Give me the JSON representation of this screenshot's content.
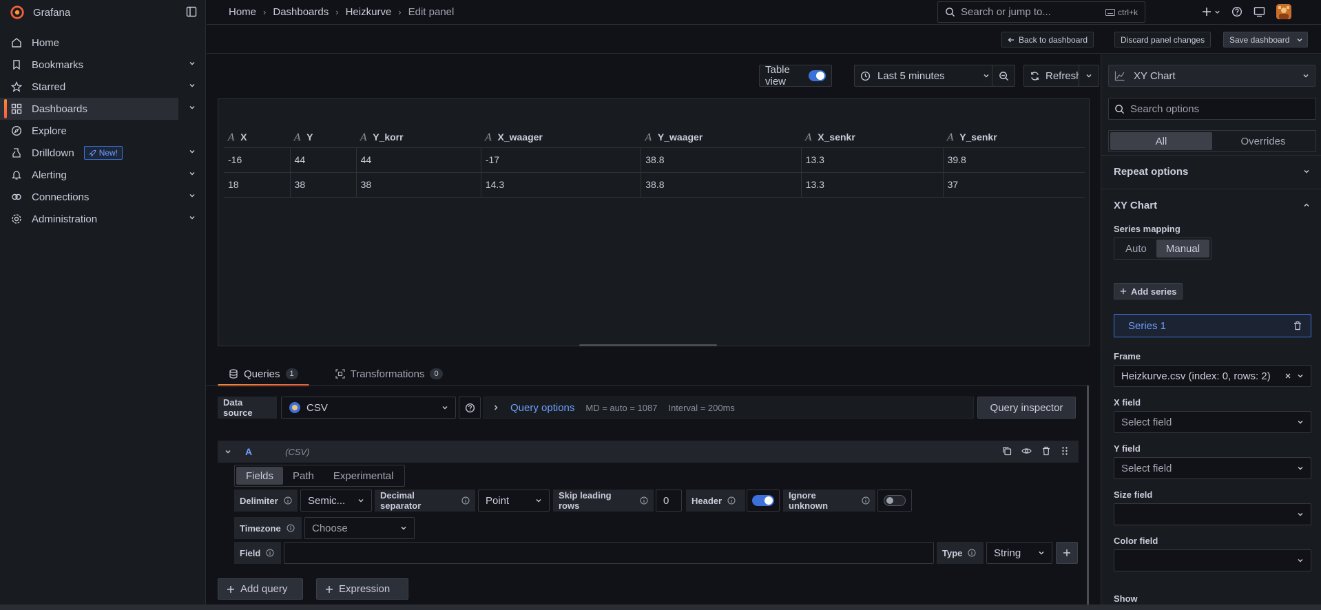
{
  "app": {
    "title": "Grafana"
  },
  "sidebar": {
    "items": [
      {
        "label": "Home",
        "icon": "home-icon",
        "chevron": false,
        "active": false
      },
      {
        "label": "Bookmarks",
        "icon": "bookmark-icon",
        "chevron": true,
        "active": false
      },
      {
        "label": "Starred",
        "icon": "star-icon",
        "chevron": true,
        "active": false
      },
      {
        "label": "Dashboards",
        "icon": "apps-icon",
        "chevron": true,
        "active": true
      },
      {
        "label": "Explore",
        "icon": "compass-icon",
        "chevron": false,
        "active": false
      },
      {
        "label": "Drilldown",
        "icon": "drilldown-icon",
        "chevron": true,
        "active": false,
        "badge": "New!"
      },
      {
        "label": "Alerting",
        "icon": "bell-icon",
        "chevron": true,
        "active": false
      },
      {
        "label": "Connections",
        "icon": "link-icon",
        "chevron": true,
        "active": false
      },
      {
        "label": "Administration",
        "icon": "cog-icon",
        "chevron": true,
        "active": false
      }
    ]
  },
  "breadcrumb": [
    "Home",
    "Dashboards",
    "Heizkurve",
    "Edit panel"
  ],
  "search": {
    "placeholder": "Search or jump to...",
    "shortcut": "ctrl+k"
  },
  "toolbar": {
    "back": "Back to dashboard",
    "discard": "Discard panel changes",
    "save": "Save dashboard"
  },
  "preview": {
    "table_view_label": "Table view",
    "time_range": "Last 5 minutes",
    "refresh": "Refresh",
    "table": {
      "columns": [
        "X",
        "Y",
        "Y_korr",
        "X_waager",
        "Y_waager",
        "X_senkr",
        "Y_senkr"
      ],
      "rows": [
        [
          "-16",
          "44",
          "44",
          "-17",
          "38.8",
          "13.3",
          "39.8"
        ],
        [
          "18",
          "38",
          "38",
          "14.3",
          "38.8",
          "13.3",
          "37"
        ]
      ]
    }
  },
  "tabs": {
    "queries": {
      "label": "Queries",
      "count": "1"
    },
    "transformations": {
      "label": "Transformations",
      "count": "0"
    }
  },
  "query": {
    "datasource_label": "Data source",
    "datasource_value": "CSV",
    "options_link": "Query options",
    "md_text": "MD = auto = 1087",
    "interval_text": "Interval = 200ms",
    "inspector": "Query inspector",
    "ref_id": "A",
    "ds_name": "(CSV)",
    "modes": [
      "Fields",
      "Path",
      "Experimental"
    ],
    "delimiter_label": "Delimiter",
    "delimiter_value": "Semic...",
    "decimal_label": "Decimal separator",
    "decimal_value": "Point",
    "skip_label": "Skip leading rows",
    "skip_value": "0",
    "header_label": "Header",
    "ignore_label": "Ignore unknown",
    "timezone_label": "Timezone",
    "timezone_placeholder": "Choose",
    "field_label": "Field",
    "type_label": "Type",
    "type_value": "String",
    "add_query": "Add query",
    "expression": "Expression"
  },
  "options": {
    "viz": "XY Chart",
    "search_placeholder": "Search options",
    "all": "All",
    "overrides": "Overrides",
    "repeat_section": "Repeat options",
    "xy_section": "XY Chart",
    "series_mapping_label": "Series mapping",
    "mapping_auto": "Auto",
    "mapping_manual": "Manual",
    "add_series": "Add series",
    "series_name": "Series 1",
    "frame_label": "Frame",
    "frame_value": "Heizkurve.csv (index: 0, rows: 2)",
    "x_field_label": "X field",
    "y_field_label": "Y field",
    "select_placeholder": "Select field",
    "size_field_label": "Size field",
    "color_field_label": "Color field",
    "show_label": "Show"
  },
  "colors": {
    "accent": "#3d71d9",
    "brand": "#f55f3e",
    "link": "#6e9fff"
  }
}
